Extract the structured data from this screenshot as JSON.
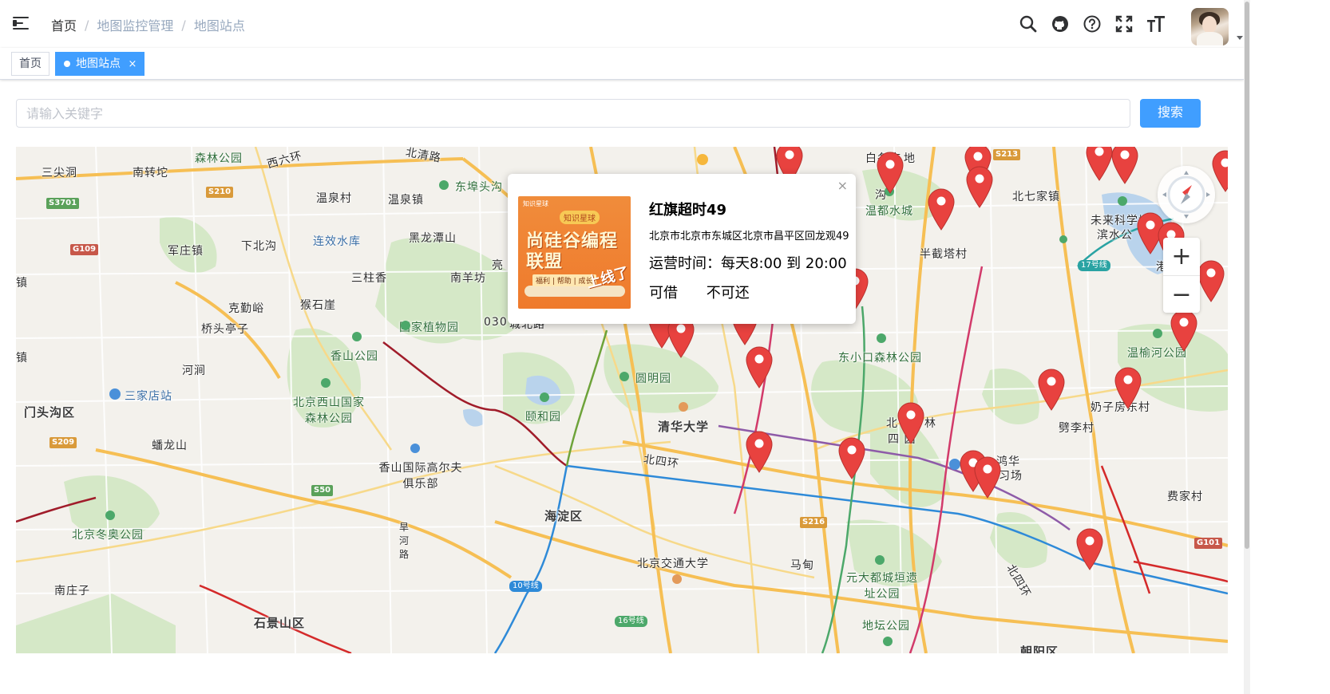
{
  "navbar": {
    "breadcrumb": [
      "首页",
      "地图监控管理",
      "地图站点"
    ],
    "separator": "/",
    "icons": [
      "search-icon",
      "github-icon",
      "question-icon",
      "fullscreen-icon",
      "text-size-icon"
    ]
  },
  "tags": {
    "home": "首页",
    "active": "地图站点",
    "close": "×"
  },
  "search": {
    "placeholder": "请输入关键字",
    "value": "",
    "button": "搜索"
  },
  "map": {
    "places": [
      "三尖洞",
      "南转坨",
      "森林公园",
      "西六环",
      "北清路",
      "温泉村",
      "温泉镇",
      "东埠头沟",
      "白各庄",
      "地",
      "北七家镇",
      "未来科学城",
      "滨水公",
      "S3701",
      "G109",
      "S210",
      "S213",
      "军庄镇",
      "下北沟",
      "连效水库",
      "黑龙潭山",
      "三柱香",
      "南羊坊",
      "亮",
      "温都水城",
      "半截塔村",
      "17号线",
      "港",
      "克勤峪",
      "猴石崖",
      "桥头亭子",
      "国家植物园",
      "030",
      "城北路",
      "香山公园",
      "东小口森林公园",
      "温榆河公园",
      "河涧",
      "圆明园",
      "三家店站",
      "北京西山国家森林公园",
      "颐和园",
      "清华大学",
      "北",
      "林",
      "四 园",
      "奶子房东村",
      "门头沟区",
      "S209",
      "蟠龙山",
      "北四环",
      "鸿华",
      "练习场",
      "劈李村",
      "香山国际高尔夫俱乐部",
      "S50",
      "旱河路",
      "海淀区",
      "S216",
      "费家村",
      "北京冬奥公园",
      "北京交通大学",
      "马甸",
      "元大都城垣遗址公园",
      "G101",
      "南庄子",
      "10号线",
      "16号线",
      "石景山区",
      "地坛公园",
      "北四环",
      "朝阳区",
      "沟",
      "镇",
      "泉镇"
    ],
    "zoom_in": "+",
    "zoom_out": "−"
  },
  "info": {
    "close": "×",
    "image_tiny": "知识星球",
    "image_badge": "知识星球",
    "image_headline": "尚硅谷编程联盟",
    "image_sub": "福利 | 帮助 | 成长",
    "image_stamp": "上线了",
    "title": "红旗超时49",
    "address": "北京市北京市东城区北京市昌平区回龙观49",
    "hours": "运营时间：每天8:00 到 20:00",
    "borrow": "可借",
    "return": "不可还"
  },
  "colors": {
    "primary": "#409eff",
    "marker": "#e8423f",
    "park": "#cfe6c0",
    "water": "#b7d3ee",
    "road_major": "#f8c05a"
  }
}
